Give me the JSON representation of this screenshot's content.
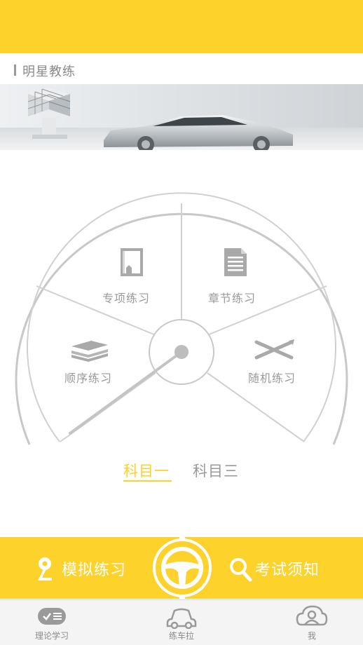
{
  "section": {
    "title": "明星教练"
  },
  "dial": {
    "segments": [
      {
        "label": "专项练习",
        "icon": "book-icon"
      },
      {
        "label": "章节练习",
        "icon": "document-icon"
      },
      {
        "label": "顺序练习",
        "icon": "stack-icon"
      },
      {
        "label": "随机练习",
        "icon": "crossed-pens-icon"
      }
    ]
  },
  "subjects": {
    "tabs": [
      "科目一",
      "科目三"
    ],
    "active": "科目一"
  },
  "actions": {
    "mock_exam": "模拟练习",
    "exam_info": "考试须知",
    "center_icon": "steering-wheel-icon"
  },
  "bottom_nav": {
    "items": [
      {
        "label": "理论学习",
        "icon": "theory-icon"
      },
      {
        "label": "练车拉",
        "icon": "car-icon"
      },
      {
        "label": "我",
        "icon": "user-icon"
      }
    ]
  },
  "colors": {
    "accent": "#FDD22B",
    "gray": "#9a9a9a",
    "nav_bg": "#f4f4f4"
  }
}
